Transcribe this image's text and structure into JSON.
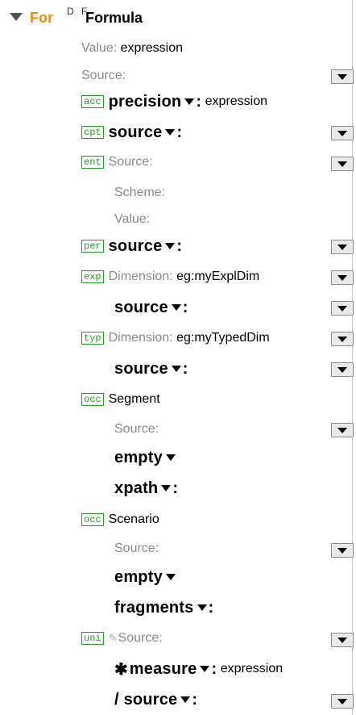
{
  "header": {
    "for_label": "For",
    "df_label": "D F",
    "formula_label": "Formula"
  },
  "rows": {
    "value_label": "Value:",
    "value_text": "expression",
    "source_label": "Source:",
    "precision": {
      "badge": "acc",
      "label": "precision",
      "value": "expression"
    },
    "cpt": {
      "badge": "cpt",
      "label": "source"
    },
    "ent": {
      "badge": "ent",
      "source_label": "Source:",
      "scheme_label": "Scheme:",
      "value_label": "Value:"
    },
    "per": {
      "badge": "per",
      "label": "source"
    },
    "exp": {
      "badge": "exp",
      "dimension_label": "Dimension:",
      "dimension_value": "eg:myExplDim",
      "source_label": "source"
    },
    "typ": {
      "badge": "typ",
      "dimension_label": "Dimension:",
      "dimension_value": "eg:myTypedDim",
      "source_label": "source"
    },
    "segment": {
      "badge": "occ",
      "label": "Segment",
      "source_label": "Source:",
      "empty_label": "empty",
      "xpath_label": "xpath"
    },
    "scenario": {
      "badge": "occ",
      "label": "Scenario",
      "source_label": "Source:",
      "empty_label": "empty",
      "fragments_label": "fragments"
    },
    "uni": {
      "badge": "uni",
      "source_label": "Source:",
      "measure_label": "measure",
      "measure_value": "expression",
      "source2_label": "source"
    }
  },
  "icons": {
    "toggle": "expand-triangle-icon",
    "dropdown": "dropdown-arrow-icon",
    "pencil": "pencil-icon"
  },
  "colors": {
    "accent": "#e8900a",
    "badge": "#22a022",
    "muted": "#8a8a8a"
  }
}
